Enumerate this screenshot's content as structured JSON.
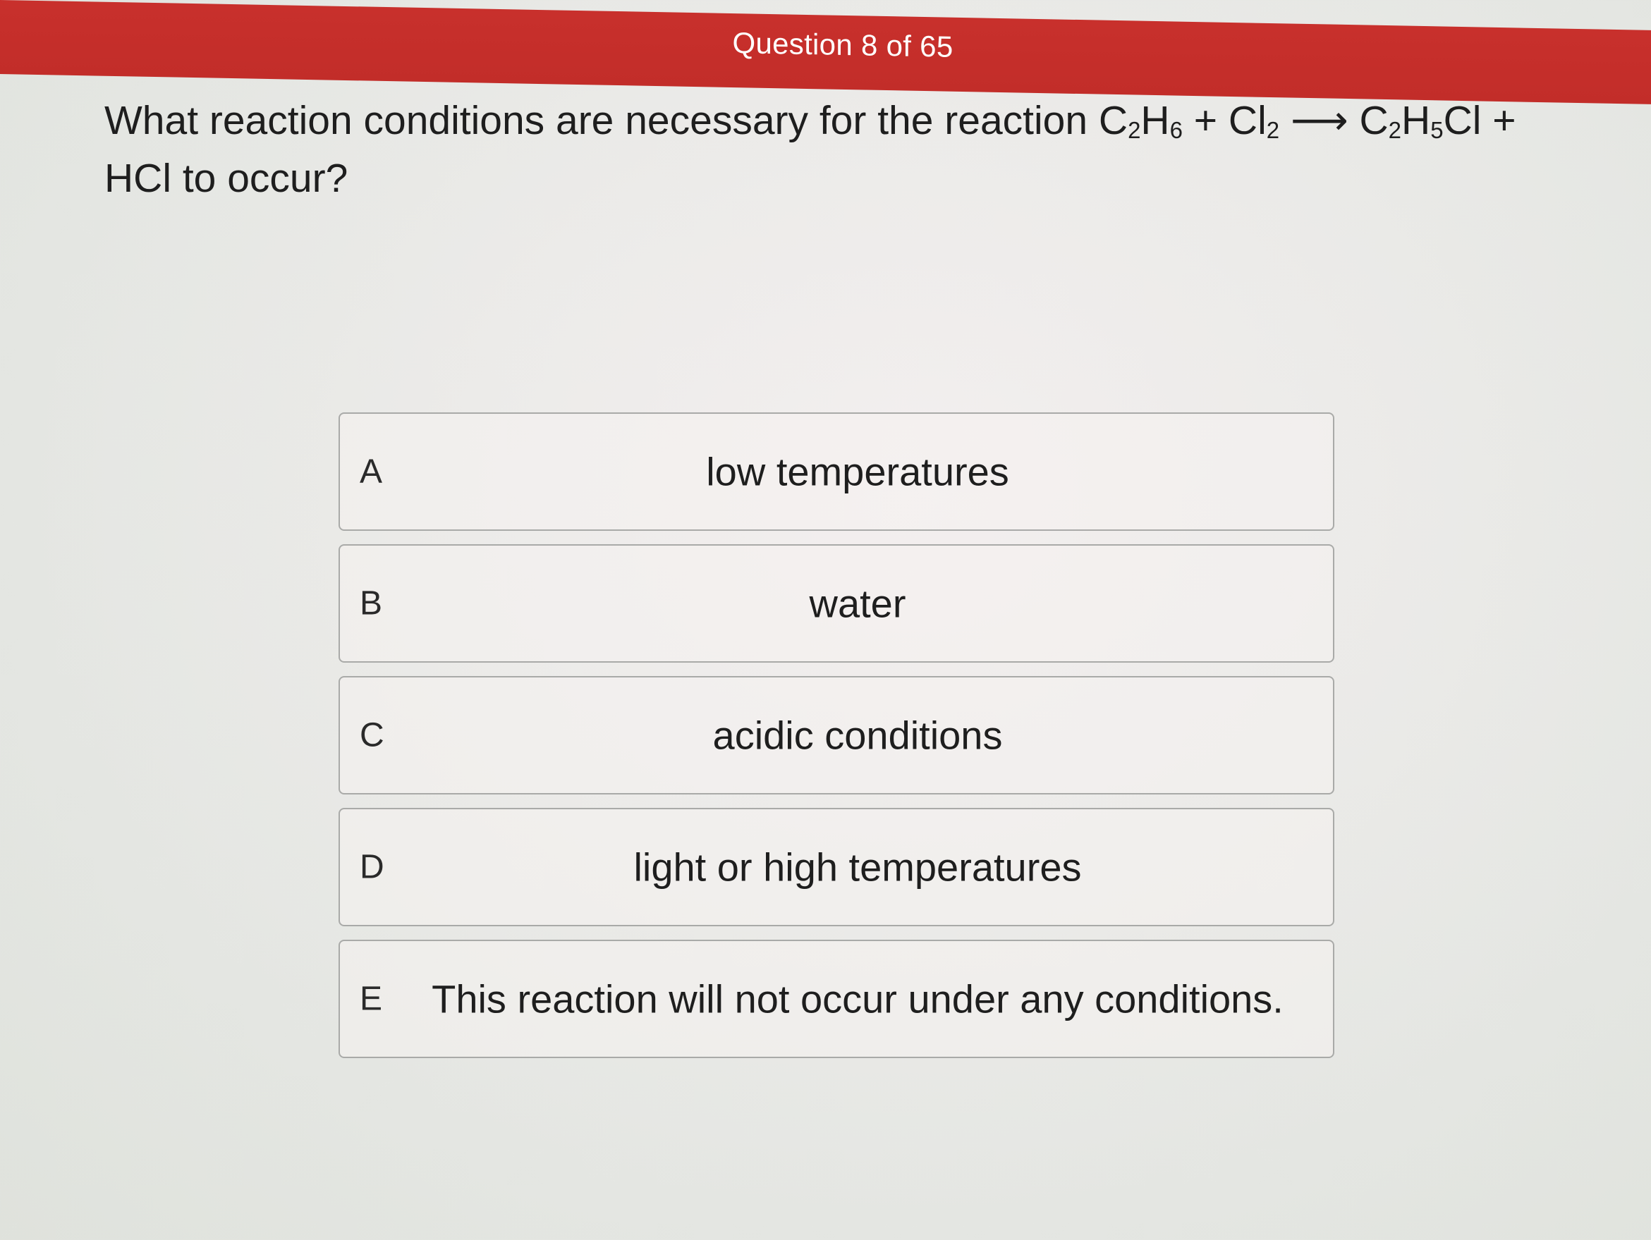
{
  "header": {
    "title": "Question 8 of 65",
    "color": "#c8302c"
  },
  "question": {
    "part1": "What reaction conditions are necessary for the reaction C",
    "sub1": "2",
    "part2": "H",
    "sub2": "6",
    "part3": " + Cl",
    "sub3": "2",
    "part4": " ⟶ C",
    "sub4": "2",
    "part5": "H",
    "sub5": "5",
    "part6": "Cl + HCl to occur?"
  },
  "options": [
    {
      "letter": "A",
      "text": "low temperatures"
    },
    {
      "letter": "B",
      "text": "water"
    },
    {
      "letter": "C",
      "text": "acidic conditions"
    },
    {
      "letter": "D",
      "text": "light or high temperatures"
    },
    {
      "letter": "E",
      "text": "This reaction will not occur under any conditions."
    }
  ]
}
